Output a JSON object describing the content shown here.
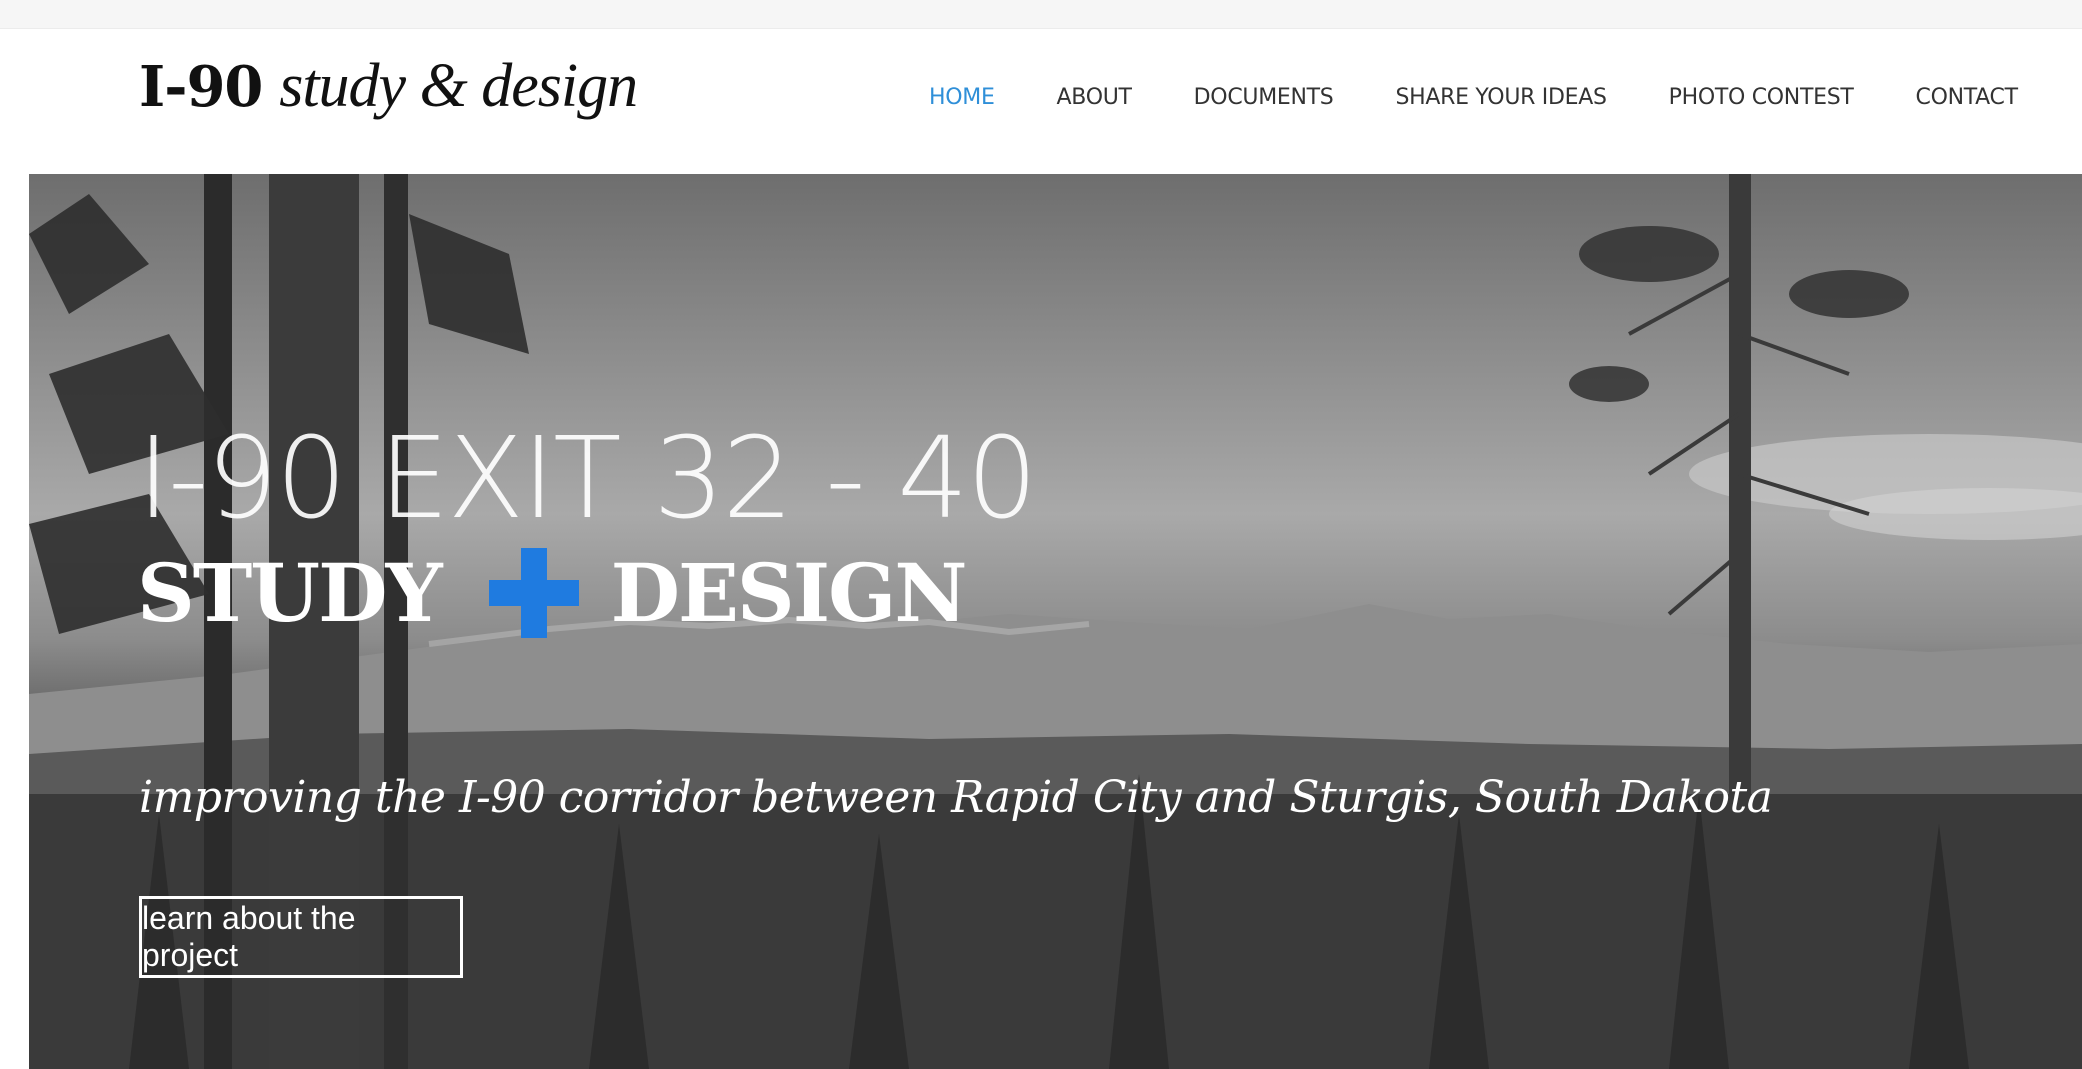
{
  "header": {
    "logo_bold": "I-90",
    "logo_italic": "study & design",
    "nav": [
      {
        "label": "HOME",
        "active": true
      },
      {
        "label": "ABOUT"
      },
      {
        "label": "DOCUMENTS"
      },
      {
        "label": "SHARE YOUR IDEAS"
      },
      {
        "label": "PHOTO CONTEST"
      },
      {
        "label": "CONTACT"
      }
    ]
  },
  "hero": {
    "title": "I-90 EXIT 32 - 40",
    "subtitle_left": "STUDY",
    "subtitle_right": "DESIGN",
    "tagline": "improving the I-90 corridor between Rapid City and Sturgis, South Dakota",
    "cta_label": "learn about the project"
  },
  "colors": {
    "accent": "#2f8fd8",
    "plus_blue": "#1f7be0",
    "text_dark": "#111111"
  },
  "icons": {
    "plus": "plus-icon"
  }
}
